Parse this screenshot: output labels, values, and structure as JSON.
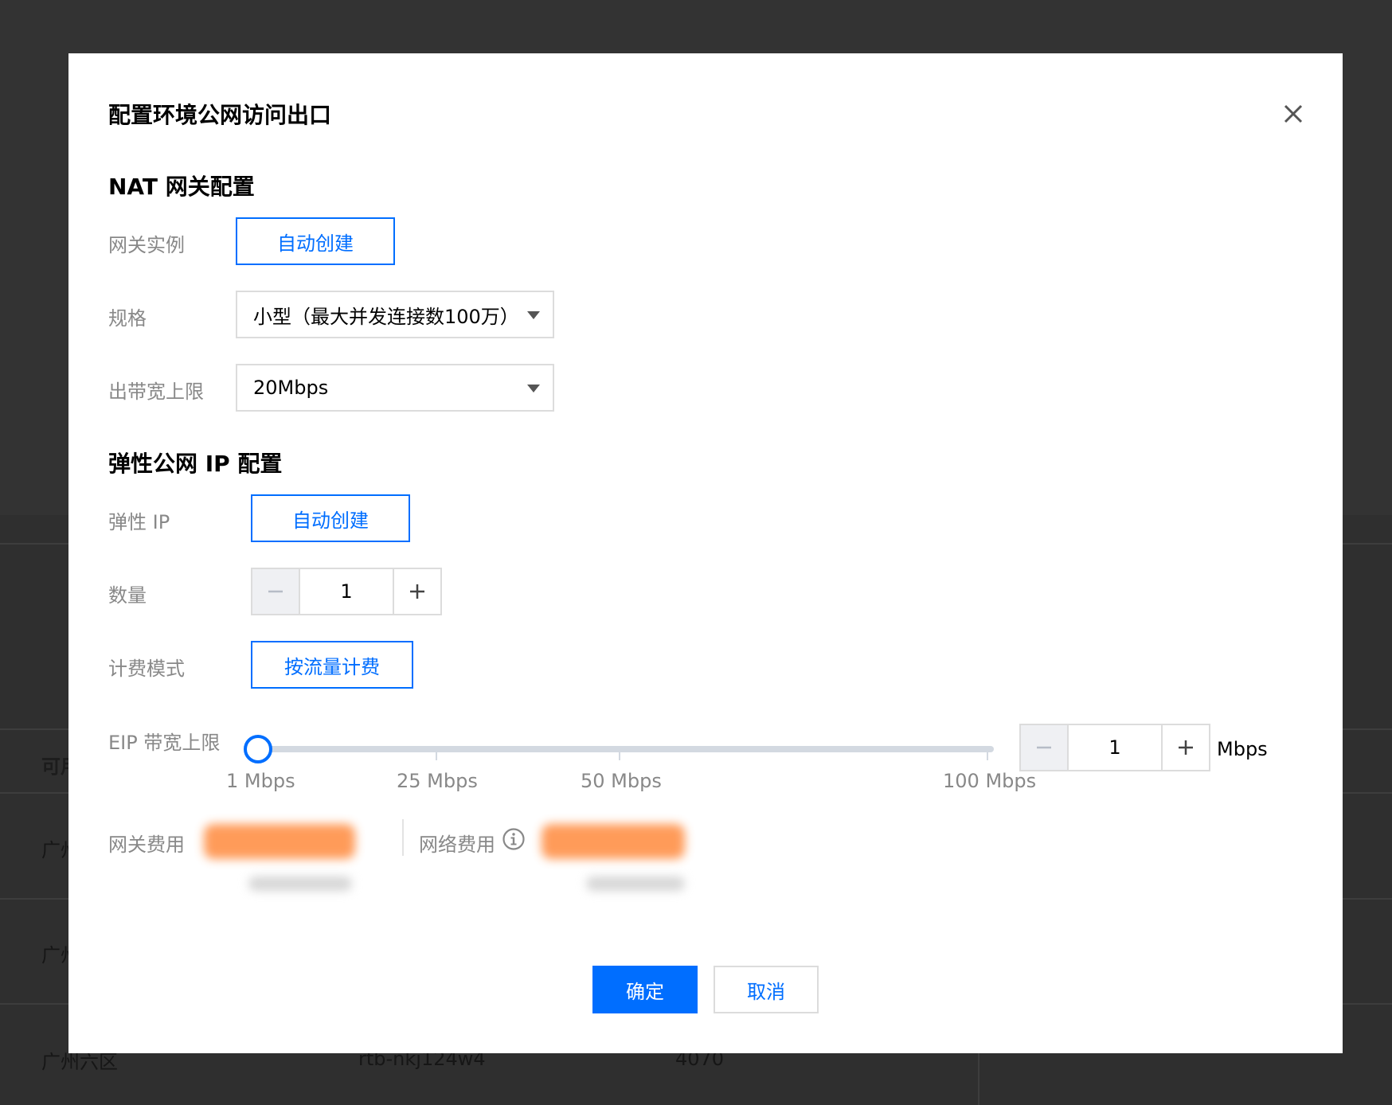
{
  "modal": {
    "title": "配置环境公网访问出口",
    "nat_section": {
      "title": "NAT 网关配置",
      "gateway_instance_label": "网关实例",
      "gateway_instance_option": "自动创建",
      "spec_label": "规格",
      "spec_value": "小型（最大并发连接数100万）",
      "bandwidth_label": "出带宽上限",
      "bandwidth_value": "20Mbps"
    },
    "eip_section": {
      "title": "弹性公网 IP 配置",
      "eip_label": "弹性 IP",
      "eip_option": "自动创建",
      "quantity_label": "数量",
      "quantity_value": "1",
      "billing_label": "计费模式",
      "billing_option": "按流量计费",
      "eip_bandwidth_label": "EIP 带宽上限",
      "slider": {
        "value": 1,
        "min": 1,
        "max": 100,
        "ticks": [
          "1 Mbps",
          "25 Mbps",
          "50 Mbps",
          "100 Mbps"
        ]
      },
      "bandwidth_stepper_value": "1",
      "bandwidth_unit": "Mbps"
    },
    "fees": {
      "gateway_fee_label": "网关费用",
      "network_fee_label": "网络费用"
    },
    "buttons": {
      "confirm": "确定",
      "cancel": "取消"
    }
  },
  "background": {
    "header_partial": "可用",
    "rows": [
      {
        "region": "广州"
      },
      {
        "region": "广州"
      },
      {
        "region": "广州六区",
        "route_table": "rtb-nkj124w4",
        "count": "4070"
      }
    ]
  },
  "colors": {
    "primary": "#006eff",
    "overlay": "#333333",
    "label_gray": "#888888",
    "price_orange": "#ff7200"
  },
  "icons": [
    "close-icon",
    "minus-icon",
    "plus-icon",
    "info-icon",
    "caret-down-icon"
  ]
}
